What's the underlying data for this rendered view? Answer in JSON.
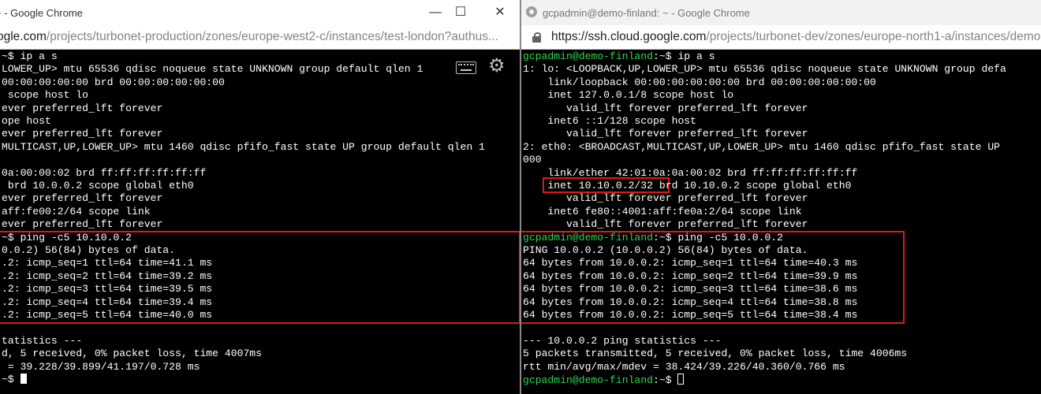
{
  "left_window": {
    "title": "~ - Google Chrome",
    "controls": {
      "minimize": "—",
      "maximize": "☐",
      "close": "✕"
    },
    "url_domain": "ogle.com",
    "url_path": "/projects/turbonet-production/zones/europe-west2-c/instances/test-london?authus...",
    "lines": [
      {
        "prompt": "~$",
        "text": " ip a s"
      },
      {
        "text": "LOWER_UP> mtu 65536 qdisc noqueue state UNKNOWN group default qlen 1"
      },
      {
        "text": "00:00:00:00:00 brd 00:00:00:00:00:00"
      },
      {
        "text": " scope host lo"
      },
      {
        "text": "ever preferred_lft forever"
      },
      {
        "text": "ope host"
      },
      {
        "text": "ever preferred_lft forever"
      },
      {
        "text": "MULTICAST,UP,LOWER_UP> mtu 1460 qdisc pfifo_fast state UP group default qlen 1"
      },
      {
        "text": ""
      },
      {
        "text": "0a:00:00:02 brd ff:ff:ff:ff:ff:ff"
      },
      {
        "text": " brd 10.0.0.2 scope global eth0"
      },
      {
        "text": "ever preferred_lft forever"
      },
      {
        "text": "aff:fe00:2/64 scope link"
      },
      {
        "text": "ever preferred_lft forever"
      },
      {
        "prompt": "~$",
        "text": " ping -c5 10.10.0.2"
      },
      {
        "text": "0.0.2) 56(84) bytes of data."
      },
      {
        "text": ".2: icmp_seq=1 ttl=64 time=41.1 ms"
      },
      {
        "text": ".2: icmp_seq=2 ttl=64 time=39.2 ms"
      },
      {
        "text": ".2: icmp_seq=3 ttl=64 time=39.5 ms"
      },
      {
        "text": ".2: icmp_seq=4 ttl=64 time=39.4 ms"
      },
      {
        "text": ".2: icmp_seq=5 ttl=64 time=40.0 ms"
      },
      {
        "text": ""
      },
      {
        "text": "tatistics ---"
      },
      {
        "text": "d, 5 received, 0% packet loss, time 4007ms"
      },
      {
        "text": " = 39.228/39.899/41.197/0.728 ms"
      },
      {
        "prompt": "~$",
        "text": " ",
        "cursor": "solid"
      }
    ]
  },
  "right_window": {
    "title": "gcpadmin@demo-finland: ~ - Google Chrome",
    "url_domain": "https://ssh.cloud.google.com",
    "url_path": "/projects/turbonet-dev/zones/europe-north1-a/instances/demo",
    "lines": [
      {
        "prompt": "gcpadmin@demo-finland",
        "suffix": ":~$",
        "text": " ip a s"
      },
      {
        "text": "1: lo: <LOOPBACK,UP,LOWER_UP> mtu 65536 qdisc noqueue state UNKNOWN group defa"
      },
      {
        "text": "    link/loopback 00:00:00:00:00:00 brd 00:00:00:00:00:00"
      },
      {
        "text": "    inet 127.0.0.1/8 scope host lo"
      },
      {
        "text": "       valid_lft forever preferred_lft forever"
      },
      {
        "text": "    inet6 ::1/128 scope host"
      },
      {
        "text": "       valid_lft forever preferred_lft forever"
      },
      {
        "text": "2: eth0: <BROADCAST,MULTICAST,UP,LOWER_UP> mtu 1460 qdisc pfifo_fast state UP"
      },
      {
        "text": "000"
      },
      {
        "text": "    link/ether 42:01:0a:0a:00:02 brd ff:ff:ff:ff:ff:ff"
      },
      {
        "text": "    inet 10.10.0.2/32 brd 10.10.0.2 scope global eth0"
      },
      {
        "text": "       valid_lft forever preferred_lft forever"
      },
      {
        "text": "    inet6 fe80::4001:aff:fe0a:2/64 scope link"
      },
      {
        "text": "       valid_lft forever preferred_lft forever"
      },
      {
        "prompt": "gcpadmin@demo-finland",
        "suffix": ":~$",
        "text": " ping -c5 10.0.0.2"
      },
      {
        "text": "PING 10.0.0.2 (10.0.0.2) 56(84) bytes of data."
      },
      {
        "text": "64 bytes from 10.0.0.2: icmp_seq=1 ttl=64 time=40.3 ms"
      },
      {
        "text": "64 bytes from 10.0.0.2: icmp_seq=2 ttl=64 time=39.9 ms"
      },
      {
        "text": "64 bytes from 10.0.0.2: icmp_seq=3 ttl=64 time=38.6 ms"
      },
      {
        "text": "64 bytes from 10.0.0.2: icmp_seq=4 ttl=64 time=38.8 ms"
      },
      {
        "text": "64 bytes from 10.0.0.2: icmp_seq=5 ttl=64 time=38.4 ms"
      },
      {
        "text": ""
      },
      {
        "text": "--- 10.0.0.2 ping statistics ---"
      },
      {
        "text": "5 packets transmitted, 5 received, 0% packet loss, time 4006ms"
      },
      {
        "text": "rtt min/avg/max/mdev = 38.424/39.226/40.360/0.766 ms"
      },
      {
        "prompt": "gcpadmin@demo-finland",
        "suffix": ":~$",
        "text": " ",
        "cursor": "hollow"
      }
    ]
  },
  "icons": {
    "keyboard": "keyboard-icon",
    "settings": "gear-icon",
    "lock": "lock-icon"
  },
  "colors": {
    "prompt": "#2bd64b",
    "highlight": "#e01818",
    "terminal_bg": "#000000"
  }
}
